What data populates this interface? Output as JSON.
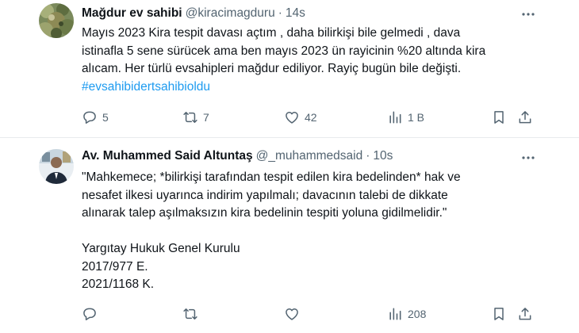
{
  "tweets": [
    {
      "display_name": "Mağdur ev sahibi",
      "handle": "@kiracimagduru",
      "separator": "·",
      "time": "14s",
      "body_lines": [
        "Mayıs 2023 Kira tespit davası açtım , daha bilirkişi bile gelmedi , dava",
        "istinafla 5 sene sürücek ama ben mayıs 2023 ün rayicinin %20 altında kira",
        "alıcam. Her türlü evsahipleri mağdur ediliyor. Rayiç bugün bile değişti."
      ],
      "hashtag": "#evsahibidertsahibioldu",
      "replies": "5",
      "retweets": "7",
      "likes": "42",
      "views": "1 B",
      "icons": [
        "reply-icon",
        "retweet-icon",
        "like-icon",
        "views-icon",
        "bookmark-icon",
        "share-icon",
        "more-icon"
      ]
    },
    {
      "display_name": "Av. Muhammed Said Altuntaş",
      "handle": "@_muhammedsaid",
      "separator": "·",
      "time": "10s",
      "body_lines": [
        "\"Mahkemece; *bilirkişi tarafından tespit edilen kira bedelinden* hak ve",
        "nesafet ilkesi uyarınca indirim yapılmalı; davacının talebi de dikkate",
        "alınarak talep aşılmaksızın kira bedelinin tespiti yoluna gidilmelidir.\""
      ],
      "citation_lines": [
        "Yargıtay Hukuk Genel Kurulu",
        "2017/977 E.",
        "2021/1168 K."
      ],
      "replies": "",
      "retweets": "",
      "likes": "",
      "views": "208",
      "icons": [
        "reply-icon",
        "retweet-icon",
        "like-icon",
        "views-icon",
        "bookmark-icon",
        "share-icon",
        "more-icon"
      ]
    }
  ],
  "colors": {
    "text": "#0f1419",
    "secondary": "#536471",
    "link": "#1d9bf0",
    "divider": "#e8ebed"
  }
}
